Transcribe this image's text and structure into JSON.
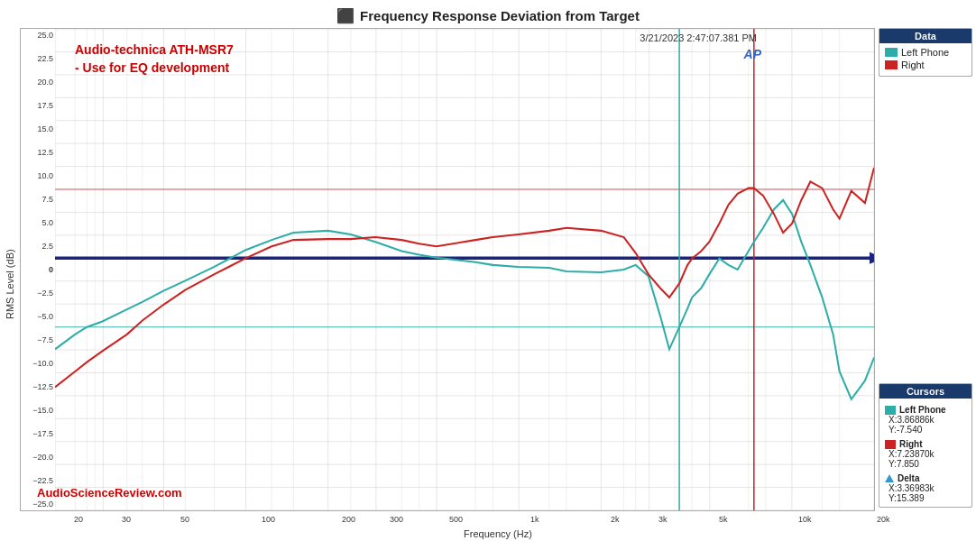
{
  "title": "Frequency Response Deviation from Target",
  "timestamp": "3/21/2023 2:47:07.381 PM",
  "ap_logo": "AP",
  "headphone_name": "Audio-technica ATH-MSR7",
  "headphone_subtitle": "- Use for EQ development",
  "watermark": "AudioScienceReview.com",
  "y_axis_label": "RMS Level (dB)",
  "x_axis_label": "Frequency (Hz)",
  "y_ticks": [
    "25.0",
    "22.5",
    "20.0",
    "17.5",
    "15.0",
    "12.5",
    "10.0",
    "7.5",
    "5.0",
    "2.5",
    "0",
    "−2.5",
    "−5.0",
    "−7.5",
    "−10.0",
    "−12.5",
    "−15.0",
    "−17.5",
    "−20.0",
    "−22.5",
    "−25.0"
  ],
  "x_ticks": [
    "20",
    "30",
    "50",
    "100",
    "200",
    "300",
    "500",
    "1k",
    "2k",
    "3k",
    "5k",
    "10k",
    "20k"
  ],
  "sidebar": {
    "data_title": "Data",
    "left_phone_label": "Left Phone",
    "right_label": "Right",
    "cursors_title": "Cursors",
    "left_phone_cursor": "Left Phone",
    "left_phone_x": "X:3.86886k",
    "left_phone_y": "Y:-7.540",
    "right_cursor": "Right",
    "right_x": "X:7.23870k",
    "right_y": "Y:7.850",
    "delta_label": "Delta",
    "delta_x": "X:3.36983k",
    "delta_y": "Y:15.389"
  },
  "colors": {
    "left_phone": "#2dada8",
    "right": "#cc2222",
    "zero_line": "#1a237e",
    "upper_limit": "#cc2222",
    "lower_limit": "#2dada8",
    "grid": "#cccccc",
    "cursor_left": "#2dada8",
    "cursor_right": "#cc2222"
  }
}
